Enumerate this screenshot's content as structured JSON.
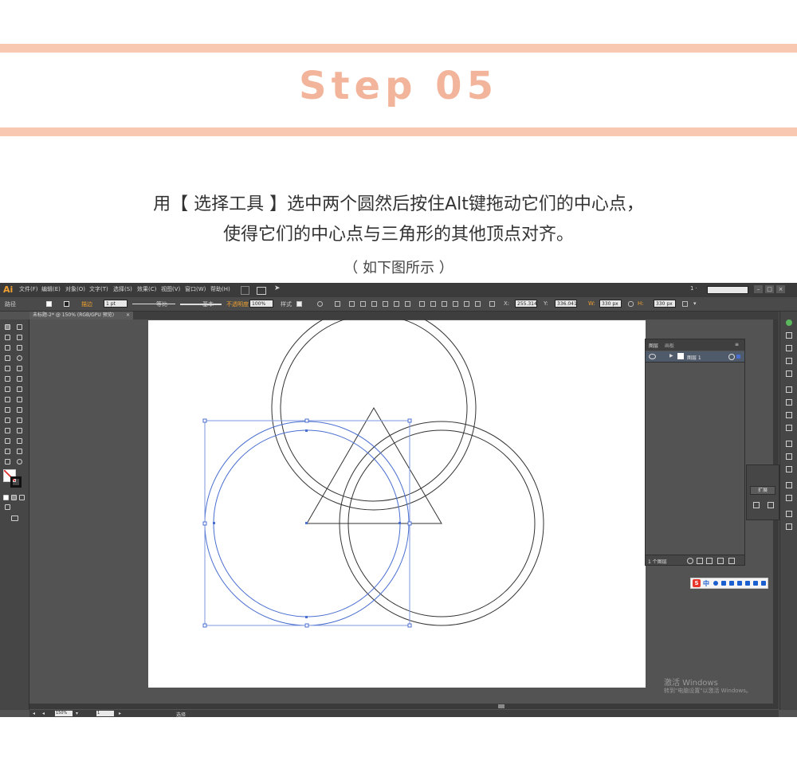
{
  "header": {
    "step_title": "Step 05",
    "instruction_line1": "用【 选择工具 】选中两个圆然后按住Alt键拖动它们的中心点，",
    "instruction_line2": "使得它们的中心点与三角形的其他顶点对齐。",
    "note": "（ 如下图所示 ）"
  },
  "colors": {
    "band": "#f8c8b0",
    "title": "#f2b49a",
    "selection": "#4a6fd0",
    "ai_logo": "#f0a030"
  },
  "app": {
    "logo": "Ai",
    "menus": [
      "文件(F)",
      "编辑(E)",
      "对象(O)",
      "文字(T)",
      "选择(S)",
      "效果(C)",
      "视图(V)",
      "窗口(W)",
      "帮助(H)"
    ],
    "workspace_num": "1 ·",
    "control_bar": {
      "object_label": "路径",
      "stroke_label": "描边",
      "stroke_value": "1 pt",
      "profile_label": "等比",
      "brush_label": "基本",
      "opacity_label": "不透明度",
      "opacity_value": "100%",
      "style_label": "样式",
      "x_value": "255.314",
      "y_value": "336.041",
      "w_value": "330 px",
      "h_value": "330 px"
    },
    "doc_tab": "未标题-2* @ 150% (RGB/GPU 预览)",
    "doc_tab_close": "×",
    "status": {
      "zoom": "150%",
      "page": "1",
      "tool": "选择"
    }
  },
  "layers_panel": {
    "tabs": [
      "图层",
      "画板"
    ],
    "layer_name": "图层 1",
    "footer": "1 个图层"
  },
  "side_panel": {
    "expand_label": "扩展"
  },
  "ime": {
    "logo": "S",
    "mode": "中"
  },
  "watermark": {
    "line1": "激活 Windows",
    "line2": "转到\"电脑设置\"以激活 Windows。"
  }
}
